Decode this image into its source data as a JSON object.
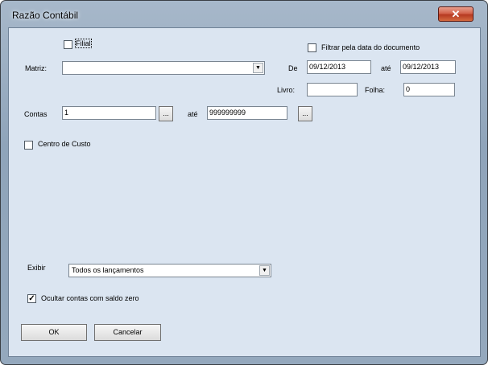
{
  "window": {
    "title": "Razão Contábil",
    "close_icon": "✕"
  },
  "filial": {
    "label": "Filial",
    "checked": false
  },
  "matriz": {
    "label": "Matriz:",
    "value": ""
  },
  "filtro_data": {
    "label": "Filtrar pela data do documento",
    "checked": false
  },
  "periodo": {
    "de_label": "De",
    "de_value": "09/12/2013",
    "ate_label": "até",
    "ate_value": "09/12/2013"
  },
  "livro": {
    "label": "Livro:",
    "value": ""
  },
  "folha": {
    "label": "Folha:",
    "value": "0"
  },
  "contas": {
    "label": "Contas",
    "de_value": "1",
    "ate_label": "até",
    "ate_value": "999999999",
    "browse_label": "..."
  },
  "centro_custo": {
    "label": "Centro de Custo",
    "checked": false
  },
  "exibir": {
    "label": "Exibir",
    "value": "Todos os lançamentos"
  },
  "ocultar": {
    "label": "Ocultar contas com saldo zero",
    "checked": true
  },
  "buttons": {
    "ok": "OK",
    "cancel": "Cancelar"
  }
}
